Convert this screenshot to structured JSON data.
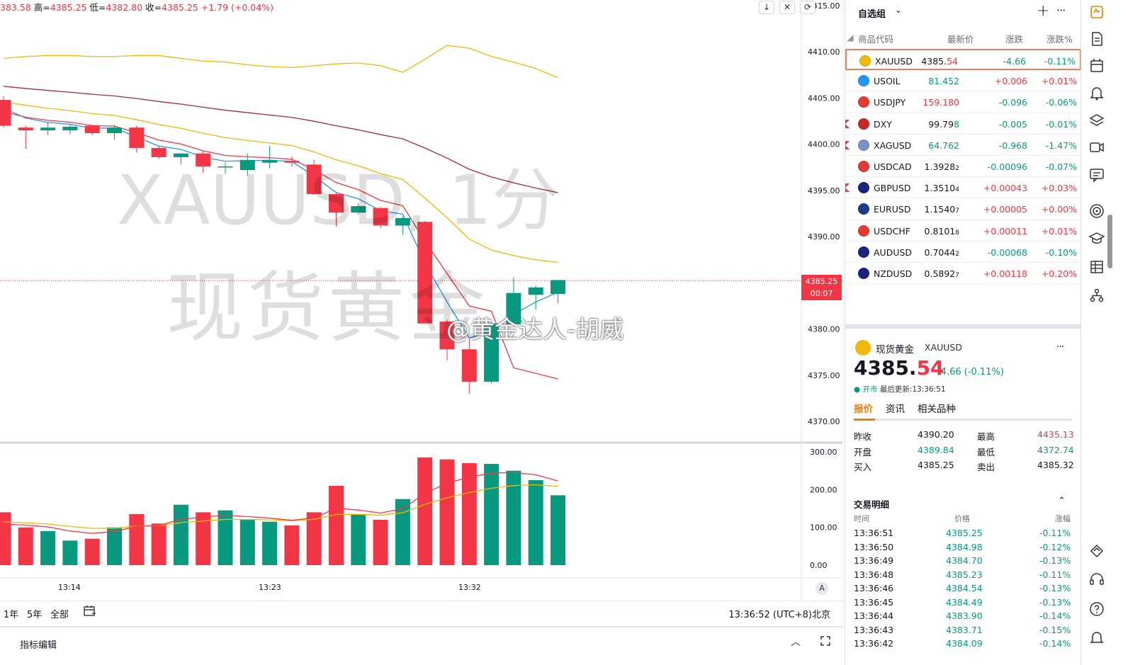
{
  "ohlc": {
    "open_fragment": "383.58",
    "high_label": "高=",
    "high": "4385.25",
    "low_label": "低=",
    "low": "4382.80",
    "close_label": "收=",
    "close": "4385.25",
    "change": "+1.79 (+0.04%)"
  },
  "chart_buttons": [
    "↓",
    "✕",
    "⟳"
  ],
  "watermark": {
    "symbol_interval": "XAUUSD, 1分",
    "name": "现货黄金",
    "weibo": "@黄金达人-胡威"
  },
  "price_axis": {
    "labels": [
      "4415.00",
      "4410.00",
      "4405.00",
      "4400.00",
      "4395.00",
      "4390.00",
      "4385.00",
      "4380.00",
      "4375.00",
      "4370.00"
    ],
    "current_price": "4385.25",
    "countdown": "00:07"
  },
  "volume_axis": {
    "labels": [
      "300.00",
      "200.00",
      "100.00",
      "0.00"
    ]
  },
  "time_axis": {
    "labels": [
      "13:14",
      "13:23",
      "13:32"
    ],
    "auto_label": "A"
  },
  "bottom_bar": {
    "ranges": [
      "1年",
      "5年",
      "全部"
    ],
    "clock": "13:36:52 (UTC+8)北京"
  },
  "indicator_bar": {
    "label": "指标编辑"
  },
  "chart_data": {
    "type": "candlestick",
    "symbol": "XAUUSD",
    "interval": "1分",
    "y_range": [
      4366,
      4416
    ],
    "volume_range": [
      0,
      300
    ],
    "candles": [
      {
        "o": 4404.8,
        "h": 4405.2,
        "l": 4401.8,
        "c": 4402.0,
        "v": 140
      },
      {
        "o": 4401.8,
        "h": 4402.0,
        "l": 4399.5,
        "c": 4401.5,
        "v": 100
      },
      {
        "o": 4401.5,
        "h": 4402.4,
        "l": 4401.0,
        "c": 4401.8,
        "v": 90
      },
      {
        "o": 4401.5,
        "h": 4402.2,
        "l": 4401.1,
        "c": 4401.9,
        "v": 65
      },
      {
        "o": 4402.0,
        "h": 4402.1,
        "l": 4401.0,
        "c": 4401.2,
        "v": 70
      },
      {
        "o": 4401.2,
        "h": 4402.1,
        "l": 4400.5,
        "c": 4401.8,
        "v": 100
      },
      {
        "o": 4401.8,
        "h": 4402.0,
        "l": 4399.1,
        "c": 4399.6,
        "v": 135
      },
      {
        "o": 4399.6,
        "h": 4399.8,
        "l": 4398.4,
        "c": 4398.6,
        "v": 110
      },
      {
        "o": 4398.6,
        "h": 4399.0,
        "l": 4397.8,
        "c": 4399.0,
        "v": 160
      },
      {
        "o": 4399.0,
        "h": 4399.3,
        "l": 4396.9,
        "c": 4397.6,
        "v": 140
      },
      {
        "o": 4397.6,
        "h": 4398.0,
        "l": 4396.8,
        "c": 4397.6,
        "v": 145
      },
      {
        "o": 4397.2,
        "h": 4399.0,
        "l": 4396.6,
        "c": 4398.3,
        "v": 120
      },
      {
        "o": 4398.0,
        "h": 4399.8,
        "l": 4397.4,
        "c": 4398.3,
        "v": 115
      },
      {
        "o": 4398.2,
        "h": 4398.7,
        "l": 4397.6,
        "c": 4398.0,
        "v": 105
      },
      {
        "o": 4397.8,
        "h": 4398.3,
        "l": 4394.5,
        "c": 4394.6,
        "v": 140
      },
      {
        "o": 4394.6,
        "h": 4394.8,
        "l": 4391.1,
        "c": 4392.6,
        "v": 210
      },
      {
        "o": 4392.6,
        "h": 4393.6,
        "l": 4392.4,
        "c": 4393.3,
        "v": 135
      },
      {
        "o": 4393.1,
        "h": 4393.2,
        "l": 4390.9,
        "c": 4391.2,
        "v": 120
      },
      {
        "o": 4391.2,
        "h": 4392.2,
        "l": 4390.2,
        "c": 4392.0,
        "v": 175
      },
      {
        "o": 4391.6,
        "h": 4391.7,
        "l": 4380.6,
        "c": 4380.6,
        "v": 285
      },
      {
        "o": 4380.8,
        "h": 4381.0,
        "l": 4376.6,
        "c": 4377.8,
        "v": 280
      },
      {
        "o": 4377.8,
        "h": 4379.0,
        "l": 4373.0,
        "c": 4374.3,
        "v": 270
      },
      {
        "o": 4374.3,
        "h": 4380.7,
        "l": 4374.1,
        "c": 4380.6,
        "v": 268
      },
      {
        "o": 4380.5,
        "h": 4385.6,
        "l": 4380.3,
        "c": 4383.9,
        "v": 250
      },
      {
        "o": 4383.7,
        "h": 4384.7,
        "l": 4382.1,
        "c": 4384.5,
        "v": 225
      },
      {
        "o": 4383.8,
        "h": 4385.3,
        "l": 4382.8,
        "c": 4385.3,
        "v": 185
      }
    ],
    "time_labels": [
      "13:14",
      "13:23",
      "13:32"
    ]
  },
  "watchlist": {
    "title": "自选组",
    "add": "+",
    "more": "···",
    "columns": {
      "symbol": "商品代码",
      "last": "最新价",
      "change": "涨跌",
      "change_pct": "涨跌%"
    },
    "rows": [
      {
        "sym": "XAUUSD",
        "last_main": "4385.",
        "last_tail": "54",
        "change": "-4.66",
        "change_pct": "-0.11%",
        "dir": "down",
        "last_color": "neutral",
        "tail_color": "up",
        "flag": false,
        "icon": "gold-coin-icon",
        "icon_color": "#f0b90b",
        "selected": true
      },
      {
        "sym": "USOIL",
        "last_main": "81.452",
        "last_tail": "",
        "change": "+0.006",
        "change_pct": "+0.01%",
        "dir": "up",
        "last_color": "down",
        "tail_color": "down",
        "flag": false,
        "icon": "oil-drop-icon",
        "icon_color": "#2196f3",
        "selected": false
      },
      {
        "sym": "USDJPY",
        "last_main": "159.180",
        "last_tail": "",
        "change": "-0.096",
        "change_pct": "-0.06%",
        "dir": "down",
        "last_color": "up",
        "tail_color": "up",
        "flag": false,
        "icon": "us-jp-flag-icon",
        "icon_color": "#e53935",
        "selected": false
      },
      {
        "sym": "DXY",
        "last_main": "99.79",
        "last_tail": "8",
        "change": "-0.005",
        "change_pct": "-0.01%",
        "dir": "down",
        "last_color": "neutral",
        "tail_color": "down",
        "flag": true,
        "icon": "us-flag-icon",
        "icon_color": "#c62828",
        "selected": false
      },
      {
        "sym": "XAGUSD",
        "last_main": "64.762",
        "last_tail": "",
        "change": "-0.968",
        "change_pct": "-1.47%",
        "dir": "down",
        "last_color": "down",
        "tail_color": "down",
        "flag": true,
        "icon": "silver-coin-icon",
        "icon_color": "#7b8fc9",
        "selected": false
      },
      {
        "sym": "USDCAD",
        "last_main": "1.3928",
        "last_tail": "2",
        "change": "-0.00096",
        "change_pct": "-0.07%",
        "dir": "down",
        "last_color": "neutral",
        "tail_color": "neutral",
        "flag": false,
        "icon": "us-ca-flag-icon",
        "icon_color": "#e53935",
        "selected": false
      },
      {
        "sym": "GBPUSD",
        "last_main": "1.3510",
        "last_tail": "4",
        "change": "+0.00043",
        "change_pct": "+0.03%",
        "dir": "up",
        "last_color": "neutral",
        "tail_color": "neutral",
        "flag": true,
        "icon": "gb-us-flag-icon",
        "icon_color": "#1a237e",
        "selected": false
      },
      {
        "sym": "EURUSD",
        "last_main": "1.1540",
        "last_tail": "7",
        "change": "+0.00005",
        "change_pct": "+0.00%",
        "dir": "up",
        "last_color": "neutral",
        "tail_color": "neutral",
        "flag": false,
        "icon": "eu-us-flag-icon",
        "icon_color": "#1e3a8a",
        "selected": false
      },
      {
        "sym": "USDCHF",
        "last_main": "0.8101",
        "last_tail": "8",
        "change": "+0.00011",
        "change_pct": "+0.01%",
        "dir": "up",
        "last_color": "neutral",
        "tail_color": "neutral",
        "flag": false,
        "icon": "us-ch-flag-icon",
        "icon_color": "#e53935",
        "selected": false
      },
      {
        "sym": "AUDUSD",
        "last_main": "0.7044",
        "last_tail": "2",
        "change": "-0.00068",
        "change_pct": "-0.10%",
        "dir": "down",
        "last_color": "neutral",
        "tail_color": "neutral",
        "flag": false,
        "icon": "au-us-flag-icon",
        "icon_color": "#1a237e",
        "selected": false
      },
      {
        "sym": "NZDUSD",
        "last_main": "0.5892",
        "last_tail": "7",
        "change": "+0.00118",
        "change_pct": "+0.20%",
        "dir": "up",
        "last_color": "neutral",
        "tail_color": "neutral",
        "flag": false,
        "icon": "nz-us-flag-icon",
        "icon_color": "#1a237e",
        "selected": false
      }
    ]
  },
  "detail": {
    "name": "现货黄金",
    "symbol": "XAUUSD",
    "more": "···",
    "price_main": "4385.",
    "price_tail": "54",
    "change": "-4.66 (-0.11%)",
    "status": "● 开市",
    "updated": "最后更新:13:36:51",
    "tabs": [
      "报价",
      "资讯",
      "相关品种"
    ],
    "quote": [
      {
        "l1": "昨收",
        "v1": "4390.20",
        "c1": "neutral",
        "l2": "最高",
        "v2": "4435.13",
        "c2": "up"
      },
      {
        "l1": "开盘",
        "v1": "4389.84",
        "c1": "down",
        "l2": "最低",
        "v2": "4372.74",
        "c2": "down"
      },
      {
        "l1": "买入",
        "v1": "4385.25",
        "c1": "neutral",
        "l2": "卖出",
        "v2": "4385.32",
        "c2": "neutral"
      }
    ]
  },
  "trades": {
    "title": "交易明细",
    "collapse": "⌃",
    "columns": {
      "time": "时间",
      "price": "价格",
      "pct": "涨幅"
    },
    "rows": [
      {
        "time": "13:36:51",
        "price": "4385.25",
        "pct": "-0.11%"
      },
      {
        "time": "13:36:50",
        "price": "4384.98",
        "pct": "-0.12%"
      },
      {
        "time": "13:36:49",
        "price": "4384.70",
        "pct": "-0.13%"
      },
      {
        "time": "13:36:48",
        "price": "4385.23",
        "pct": "-0.11%"
      },
      {
        "time": "13:36:46",
        "price": "4384.54",
        "pct": "-0.13%"
      },
      {
        "time": "13:36:45",
        "price": "4384.49",
        "pct": "-0.13%"
      },
      {
        "time": "13:36:44",
        "price": "4383.90",
        "pct": "-0.14%"
      },
      {
        "time": "13:36:43",
        "price": "4383.71",
        "pct": "-0.15%"
      },
      {
        "time": "13:36:42",
        "price": "4384.09",
        "pct": "-0.14%"
      }
    ]
  },
  "side_icons": [
    "watchlist-icon",
    "document-icon",
    "calendar-icon",
    "bell-icon",
    "layers-icon",
    "video-icon",
    "chat-icon",
    "target-icon",
    "education-icon",
    "grid-icon",
    "tree-icon",
    "community-icon",
    "headset-icon",
    "help-icon",
    "notification-icon"
  ],
  "colors": {
    "up": "#f23645",
    "down": "#089981",
    "ma_blue": "#2196f3",
    "ma_red": "#f23645",
    "ma_yellow": "#f5b800",
    "ma_brown": "#a0303a",
    "accent": "#f57c00"
  }
}
